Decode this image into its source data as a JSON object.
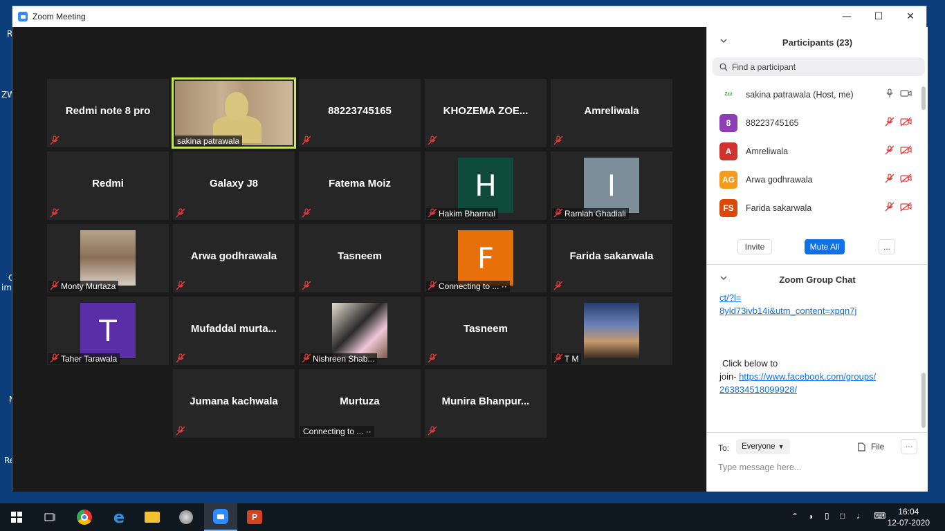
{
  "window": {
    "title": "Zoom Meeting"
  },
  "desktop_labels": [
    "R",
    "ZW",
    "C",
    "im",
    "N",
    "Re"
  ],
  "tiles": [
    {
      "name": "Redmi  note 8 pro",
      "kind": "text"
    },
    {
      "name": "sakina patrawala",
      "kind": "video"
    },
    {
      "name": "88223745165",
      "kind": "text"
    },
    {
      "name": "KHOZEMA  ZOE...",
      "kind": "text"
    },
    {
      "name": "Amreliwala",
      "kind": "text"
    },
    {
      "name": "Redmi",
      "kind": "text"
    },
    {
      "name": "Galaxy J8",
      "kind": "text"
    },
    {
      "name": "Fatema Moiz",
      "kind": "text"
    },
    {
      "name": "Hakim Bharmal",
      "kind": "avatar",
      "letter": "H",
      "color": "#0f4b3b"
    },
    {
      "name": "Ramlah Ghadiali",
      "kind": "avatar",
      "letter": "I",
      "color": "#7c8e99"
    },
    {
      "name": "Monty Murtaza",
      "kind": "photo"
    },
    {
      "name": "Arwa godhrawala",
      "kind": "text"
    },
    {
      "name": "Tasneem",
      "kind": "text"
    },
    {
      "name": "Connecting to ...",
      "kind": "avatar",
      "letter": "F",
      "color": "#e8700a"
    },
    {
      "name": "Farida sakarwala",
      "kind": "text"
    },
    {
      "name": "Taher Tarawala",
      "kind": "avatar",
      "letter": "T",
      "color": "#5a2ea6"
    },
    {
      "name": "Mufaddal  murta...",
      "kind": "text"
    },
    {
      "name": "Nishreen Shab...",
      "kind": "photo"
    },
    {
      "name": "Tasneem",
      "kind": "text"
    },
    {
      "name": "T M",
      "kind": "photo"
    },
    {
      "name": "Jumana kachwala",
      "kind": "text"
    },
    {
      "name": "Murtuza",
      "kind": "text"
    },
    {
      "name": "Munira  Bhanpur...",
      "kind": "text"
    }
  ],
  "connecting_label": "Connecting to ...",
  "participants": {
    "header": "Participants (23)",
    "search_placeholder": "Find a participant",
    "list": [
      {
        "name": "sakina patrawala (Host, me)",
        "initials": "",
        "color": "#ffffff"
      },
      {
        "name": "88223745165",
        "initials": "8",
        "color": "#8e3fb5"
      },
      {
        "name": "Amreliwala",
        "initials": "A",
        "color": "#d0322d"
      },
      {
        "name": "Arwa godhrawala",
        "initials": "AG",
        "color": "#f59a1b"
      },
      {
        "name": "Farida sakarwala",
        "initials": "FS",
        "color": "#d94a08"
      }
    ],
    "invite": "Invite",
    "mute_all": "Mute All",
    "more": "..."
  },
  "chat": {
    "header": "Zoom Group Chat",
    "link1a": "ct/?l=",
    "link1b": "8yld73ivb14i&utm_content=xpqn7j",
    "msg_prefix": "Click below to",
    "join": "join- ",
    "link2a": "https://www.facebook.com/groups/",
    "link2b": "263834518099928/",
    "to_label": "To:",
    "to_value": "Everyone",
    "file": "File",
    "placeholder": "Type message here..."
  },
  "taskbar": {
    "time": "16:04",
    "date": "12-07-2020"
  }
}
